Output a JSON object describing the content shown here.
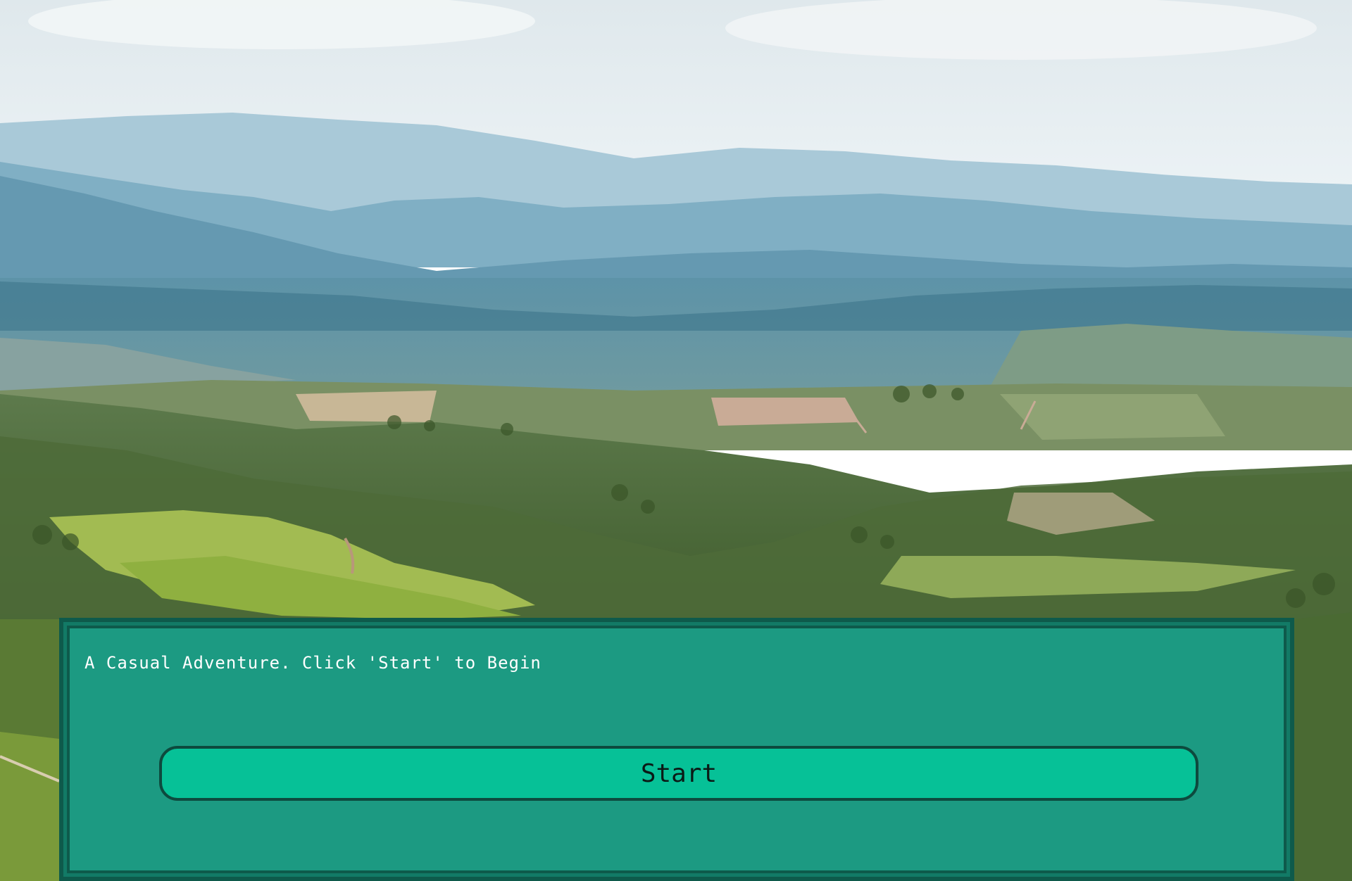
{
  "scene": {
    "background": "tuscany-hills-landscape",
    "colors": {
      "sky": "#e6eef2",
      "far_mountains": "#8fb7cc",
      "mid_mountains": "#5f95ad",
      "valley": "#4a7f93",
      "forest": "#4f6b3a",
      "field": "#9ab548"
    }
  },
  "dialog": {
    "message": "A Casual Adventure. Click 'Start' to Begin",
    "start_label": "Start",
    "colors": {
      "panel": "#1c9a82",
      "panel_border": "#0e5a4b",
      "button": "#06c197",
      "button_border": "#0d4a3e"
    }
  }
}
